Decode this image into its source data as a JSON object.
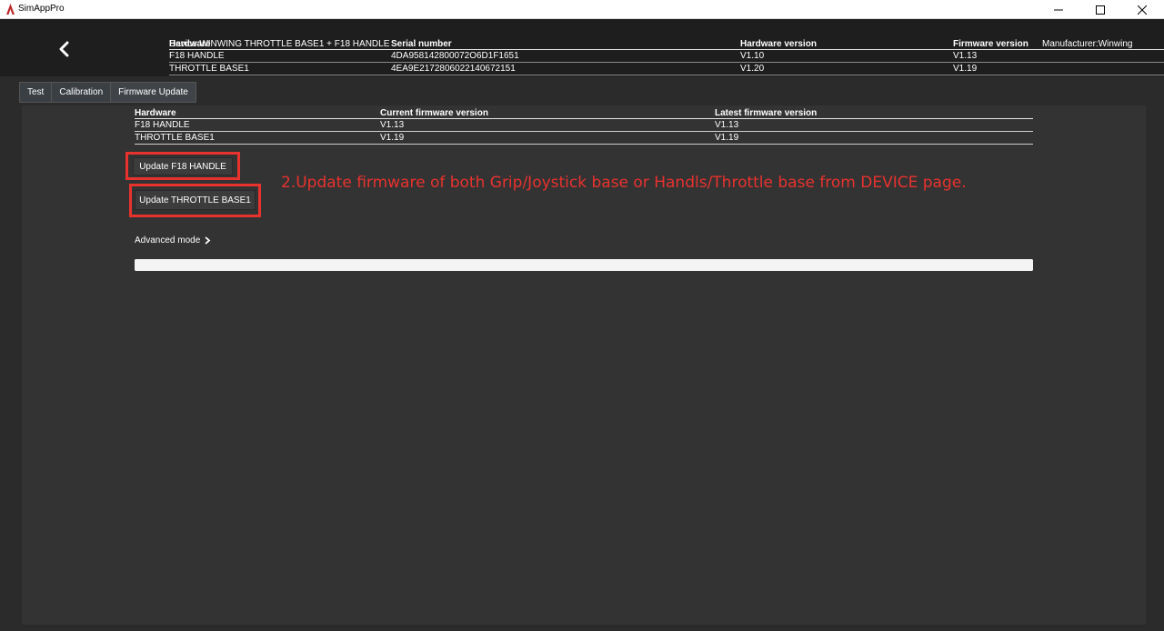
{
  "window": {
    "title": "SimAppPro"
  },
  "header": {
    "device": "Device:WINWING THROTTLE BASE1 + F18 HANDLE",
    "manufacturer": "Manufacturer:Winwing",
    "columns": [
      "Hardware",
      "Serial number",
      "Hardware version",
      "Firmware version"
    ],
    "rows": [
      [
        "F18 HANDLE",
        "4DA958142800072O6D1F1651",
        "V1.10",
        "V1.13"
      ],
      [
        "THROTTLE BASE1",
        "4EA9E2172806022140672151",
        "V1.20",
        "V1.19"
      ]
    ]
  },
  "tabs": [
    "Test",
    "Calibration",
    "Firmware Update"
  ],
  "firmware": {
    "columns": [
      "Hardware",
      "Current firmware version",
      "Latest firmware version"
    ],
    "rows": [
      [
        "F18 HANDLE",
        "V1.13",
        "V1.13"
      ],
      [
        "THROTTLE BASE1",
        "V1.19",
        "V1.19"
      ]
    ],
    "buttons": {
      "update_handle": "Update F18 HANDLE",
      "update_base": "Update THROTTLE BASE1"
    },
    "advanced_mode": "Advanced mode",
    "progress_fraction": 1.0
  },
  "annotation": "2.Update firmware of both Grip/Joystick base or Handls/Throttle base from DEVICE page.",
  "colors": {
    "annotation": "#e8322e",
    "background": "#2b2b2b",
    "header_bg": "#1e1e1e",
    "panel_bg": "#333333"
  },
  "icons": {
    "app": "simapppro-logo-icon",
    "back": "chevron-left-icon",
    "advanced": "chevron-right-icon"
  }
}
